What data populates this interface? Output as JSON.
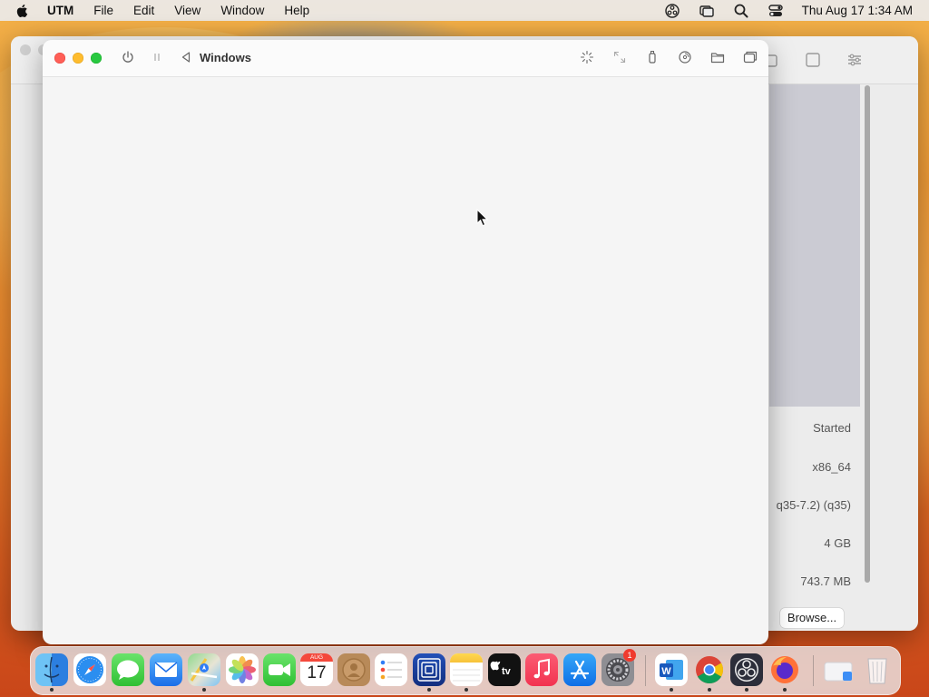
{
  "menubar": {
    "app_name": "UTM",
    "menus": [
      "File",
      "Edit",
      "View",
      "Window",
      "Help"
    ],
    "clock": "Thu Aug 17  1:34 AM"
  },
  "vm_window": {
    "title": "Windows"
  },
  "main_window": {
    "details": {
      "status": "Started",
      "architecture": "x86_64",
      "machine": "q35-7.2) (q35)",
      "memory": "4 GB",
      "size": "743.7 MB"
    },
    "browse_label": "Browse..."
  },
  "dock": {
    "calendar_month": "AUG",
    "calendar_day": "17",
    "settings_badge": "1",
    "apps": [
      "finder",
      "safari",
      "messages",
      "mail",
      "maps",
      "photos",
      "facetime",
      "calendar",
      "contacts",
      "reminders",
      "utm",
      "notes",
      "tv",
      "music",
      "app-store",
      "system-settings",
      "word",
      "chrome",
      "obs",
      "firefox",
      "downloads",
      "trash"
    ]
  },
  "colors": {
    "close": "#ff5f57",
    "minimize": "#febc2e",
    "zoom": "#28c840",
    "badge": "#f03a2e"
  }
}
